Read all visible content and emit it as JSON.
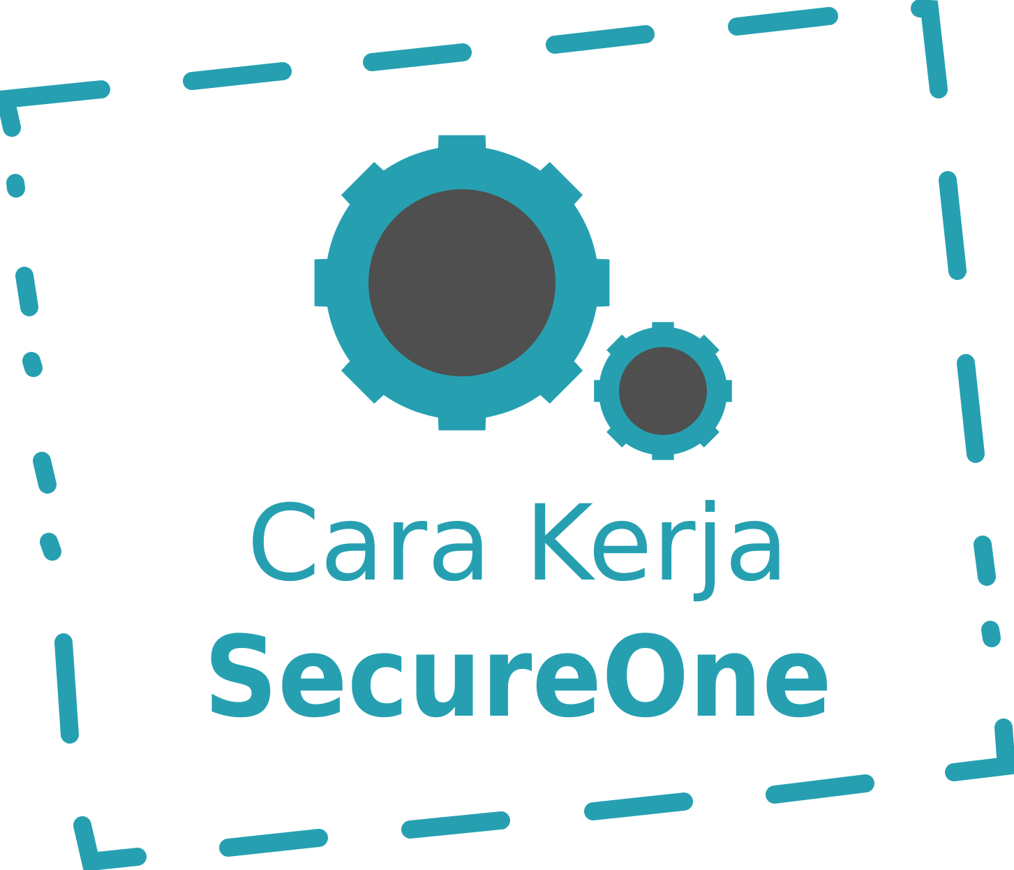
{
  "logo": {
    "line1": "Cara Kerja",
    "line2": "SecureOne"
  },
  "icons": {
    "large_gear": "gear-icon",
    "small_gear": "gear-icon",
    "frame": "dashed-frame"
  },
  "colors": {
    "accent": "#26a0b1",
    "hub": "#4f4f4f",
    "background": "#ffffff"
  }
}
